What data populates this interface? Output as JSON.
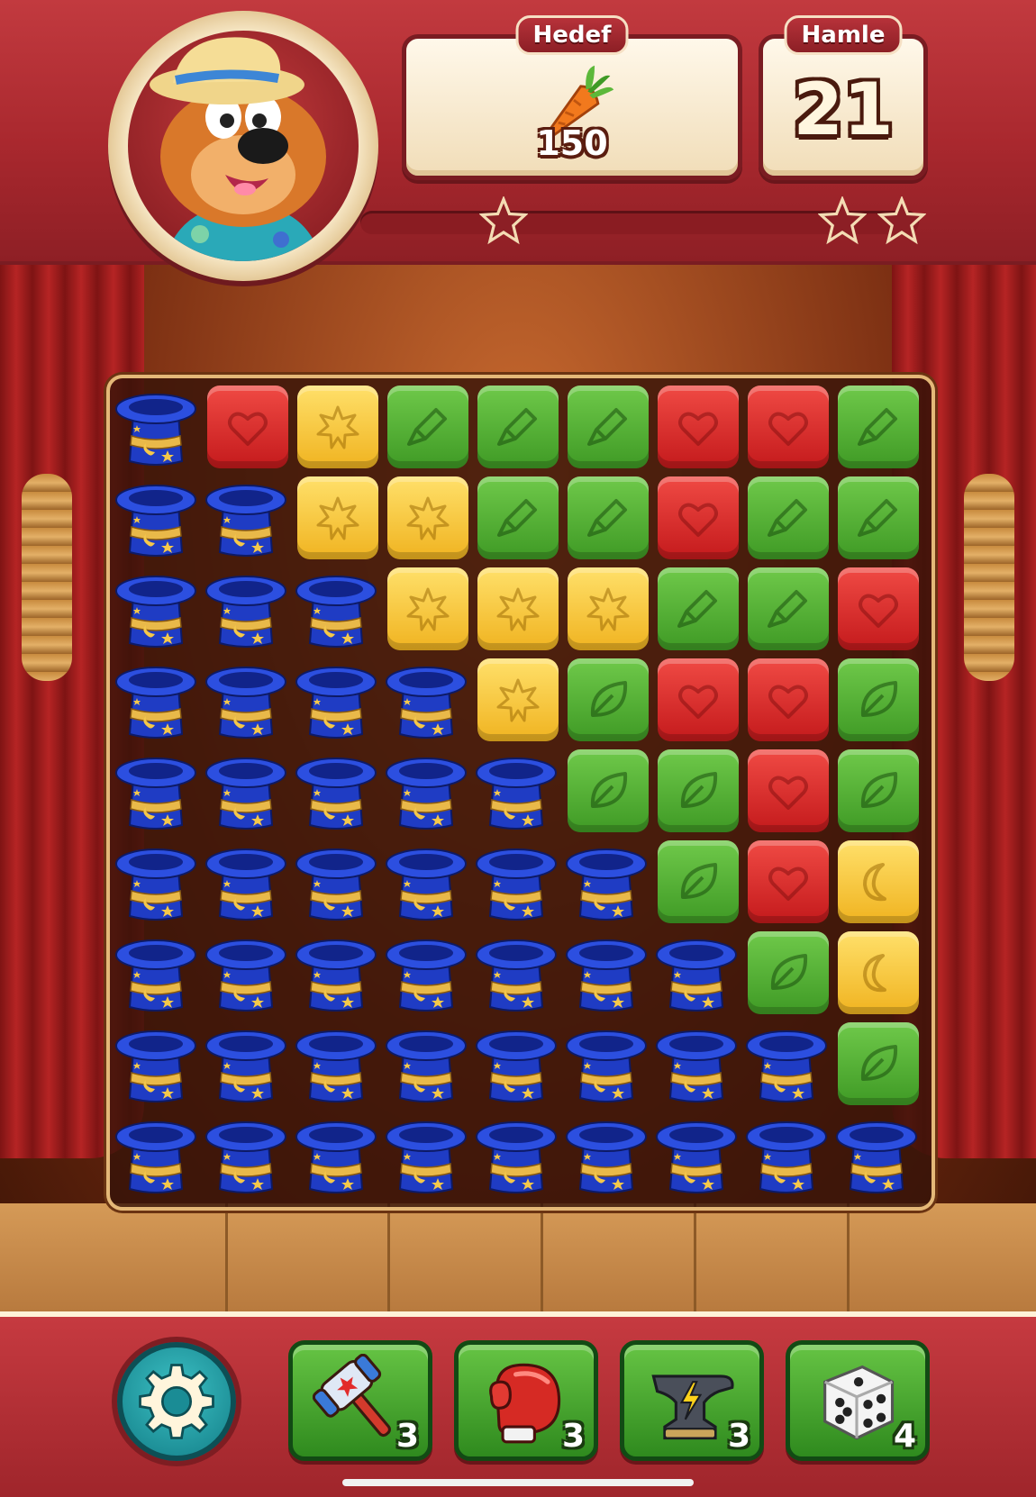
{
  "hud": {
    "goal_label": "Hedef",
    "goal_item_icon": "carrot-icon",
    "goal_count": "150",
    "moves_label": "Hamle",
    "moves_count": "21",
    "score_progress": 0.0,
    "avatar_icon": "bear-character-avatar"
  },
  "board": {
    "columns": 9,
    "rows": 9,
    "legend": {
      "R": "red-heart-block",
      "Y": "yellow-star-block",
      "G": "green-rocket-block",
      "L": "green-leaf-block",
      "M": "yellow-moon-block",
      "H": "magic-hat-obstacle"
    },
    "grid": [
      [
        "H",
        "R",
        "Y",
        "G",
        "G",
        "G",
        "R",
        "R",
        "G"
      ],
      [
        "H",
        "H",
        "Y",
        "Y",
        "G",
        "G",
        "R",
        "G",
        "G"
      ],
      [
        "H",
        "H",
        "H",
        "Y",
        "Y",
        "Y",
        "G",
        "G",
        "R"
      ],
      [
        "H",
        "H",
        "H",
        "H",
        "Y",
        "L",
        "R",
        "R",
        "L"
      ],
      [
        "H",
        "H",
        "H",
        "H",
        "H",
        "L",
        "L",
        "R",
        "L"
      ],
      [
        "H",
        "H",
        "H",
        "H",
        "H",
        "H",
        "L",
        "R",
        "M"
      ],
      [
        "H",
        "H",
        "H",
        "H",
        "H",
        "H",
        "H",
        "L",
        "M"
      ],
      [
        "H",
        "H",
        "H",
        "H",
        "H",
        "H",
        "H",
        "H",
        "L"
      ],
      [
        "H",
        "H",
        "H",
        "H",
        "H",
        "H",
        "H",
        "H",
        "H"
      ]
    ]
  },
  "boosters": [
    {
      "name": "hammer-booster",
      "icon": "hammer-icon",
      "count": "3"
    },
    {
      "name": "boxing-glove-booster",
      "icon": "boxing-glove-icon",
      "count": "3"
    },
    {
      "name": "anvil-booster",
      "icon": "anvil-icon",
      "count": "3"
    },
    {
      "name": "dice-booster",
      "icon": "dice-icon",
      "count": "4"
    }
  ],
  "settings": {
    "icon": "gear-icon"
  },
  "colors": {
    "red": "#d9282a",
    "yellow": "#f6c83a",
    "green": "#4caf2e",
    "hat_blue": "#1f3cc4",
    "hud_red": "#a9282e"
  }
}
